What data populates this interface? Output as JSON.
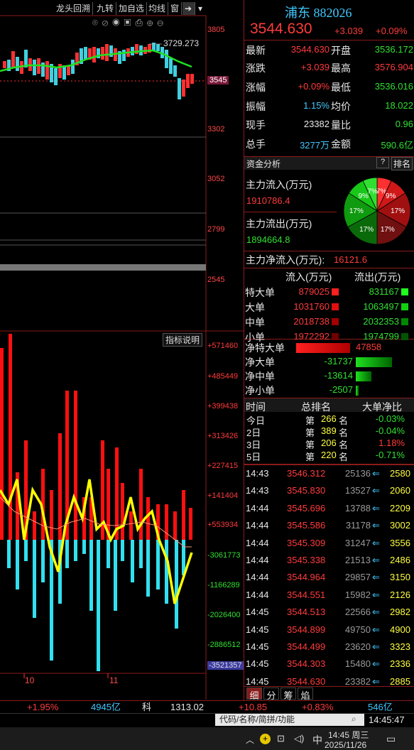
{
  "toolbar": {
    "items": [
      "龙头回溯",
      "九转",
      "加自选",
      "均线",
      "窗"
    ]
  },
  "top_chart": {
    "high_label": "3729.273",
    "y_ticks": [
      "3805",
      "3545",
      "3302",
      "3052",
      "2799",
      "2545"
    ]
  },
  "indicator": {
    "label": "指标说明",
    "y_ticks": [
      "+571460",
      "+485449",
      "+399438",
      "+313426",
      "+227415",
      "+141404",
      "+553934",
      "-3061773",
      "-1166289",
      "-2026400",
      "-2886512",
      "-3521357"
    ],
    "x_ticks": [
      "10",
      "11"
    ]
  },
  "quote": {
    "name": "浦东 882026",
    "price": "3544.630",
    "change": "+3.039",
    "change_pct": "+0.09%"
  },
  "stats": [
    {
      "l": "最新",
      "v": "3544.630",
      "l2": "开盘",
      "v2": "3536.172"
    },
    {
      "l": "涨跌",
      "v": "+3.039",
      "l2": "最高",
      "v2": "3576.904"
    },
    {
      "l": "涨幅",
      "v": "+0.09%",
      "l2": "最低",
      "v2": "3536.016"
    },
    {
      "l": "振幅",
      "v": "1.15%",
      "l2": "均价",
      "v2": "18.022"
    },
    {
      "l": "现手",
      "v": "23382",
      "l2": "量比",
      "v2": "0.96"
    },
    {
      "l": "总手",
      "v": "3277万",
      "l2": "金额",
      "v2": "590.6亿"
    }
  ],
  "capital": {
    "title": "资金分析",
    "help": "?",
    "rank": "排名",
    "inflow_label": "主力流入(万元)",
    "inflow": "1910786.4",
    "outflow_label": "主力流出(万元)",
    "outflow": "1894664.8",
    "net_label": "主力净流入(万元):",
    "net": "16121.6",
    "pie": [
      "7%",
      "9%",
      "17%",
      "17%",
      "17%",
      "17%",
      "9%",
      "7%"
    ]
  },
  "flow_table": {
    "h1": "流入(万元)",
    "h2": "流出(万元)",
    "rows": [
      {
        "l": "特大单",
        "in": "879025",
        "out": "831167"
      },
      {
        "l": "大单",
        "in": "1031760",
        "out": "1063497"
      },
      {
        "l": "中单",
        "in": "2018738",
        "out": "2032353"
      },
      {
        "l": "小单",
        "in": "1972292",
        "out": "1974799"
      }
    ]
  },
  "net_table": [
    {
      "l": "净特大单",
      "v": "47858",
      "frac": 0.95
    },
    {
      "l": "净大单",
      "v": "-31737",
      "frac": 0.64
    },
    {
      "l": "净中单",
      "v": "-13614",
      "frac": 0.28
    },
    {
      "l": "净小单",
      "v": "-2507",
      "frac": 0.05
    }
  ],
  "rank_table": {
    "h1": "时间",
    "h2": "总排名",
    "h3": "大单净比",
    "rows": [
      {
        "t": "今日",
        "r": "第",
        "n": "266",
        "u": "名",
        "p": "-0.03%"
      },
      {
        "t": "2日",
        "r": "第",
        "n": "389",
        "u": "名",
        "p": "-0.04%"
      },
      {
        "t": "3日",
        "r": "第",
        "n": "206",
        "u": "名",
        "p": "1.18%"
      },
      {
        "t": "5日",
        "r": "第",
        "n": "220",
        "u": "名",
        "p": "-0.71%"
      }
    ]
  },
  "ticks": [
    {
      "t": "14:43",
      "p": "3546.312",
      "v": "25136",
      "n": "2580"
    },
    {
      "t": "14:43",
      "p": "3545.830",
      "v": "13527",
      "n": "2060"
    },
    {
      "t": "14:44",
      "p": "3545.696",
      "v": "13788",
      "n": "2209"
    },
    {
      "t": "14:44",
      "p": "3545.586",
      "v": "31178",
      "n": "3002"
    },
    {
      "t": "14:44",
      "p": "3545.309",
      "v": "31247",
      "n": "3556"
    },
    {
      "t": "14:44",
      "p": "3545.338",
      "v": "21513",
      "n": "2486"
    },
    {
      "t": "14:44",
      "p": "3544.964",
      "v": "29857",
      "n": "3150"
    },
    {
      "t": "14:44",
      "p": "3544.551",
      "v": "15982",
      "n": "2126"
    },
    {
      "t": "14:45",
      "p": "3544.513",
      "v": "22566",
      "n": "2982"
    },
    {
      "t": "14:45",
      "p": "3544.899",
      "v": "49750",
      "n": "4900"
    },
    {
      "t": "14:45",
      "p": "3544.499",
      "v": "23620",
      "n": "3323"
    },
    {
      "t": "14:45",
      "p": "3544.303",
      "v": "15480",
      "n": "2336"
    },
    {
      "t": "14:45",
      "p": "3544.630",
      "v": "23382",
      "n": "2885"
    }
  ],
  "tabs": [
    "细",
    "分",
    "筹",
    "焰"
  ],
  "status": {
    "a": "+1.95%",
    "b": "4945亿",
    "c": "科",
    "d": "1313.02",
    "e": "+10.85",
    "f": "+0.83%",
    "g": "546亿",
    "time": "14:45:47"
  },
  "search": {
    "placeholder": "代码/名称/简拼/功能"
  },
  "taskbar": {
    "time": "14:45 周三",
    "date": "2025/11/26",
    "ime": "中"
  }
}
